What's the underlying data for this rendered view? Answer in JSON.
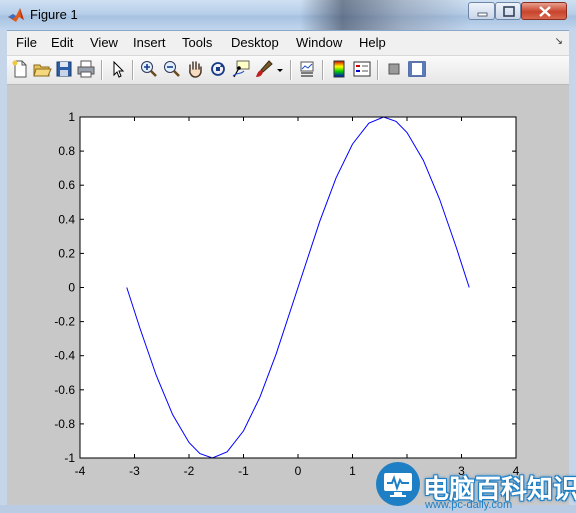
{
  "window": {
    "title": "Figure 1",
    "controls": [
      "minimize",
      "maximize",
      "close"
    ]
  },
  "menu": [
    {
      "label": "File"
    },
    {
      "label": "Edit"
    },
    {
      "label": "View"
    },
    {
      "label": "Insert"
    },
    {
      "label": "Tools"
    },
    {
      "label": "Desktop"
    },
    {
      "label": "Window"
    },
    {
      "label": "Help"
    }
  ],
  "toolbar": {
    "icons": [
      "new-figure-icon",
      "open-file-icon",
      "save-icon",
      "print-icon",
      "edit-plot-arrow-icon",
      "zoom-in-icon",
      "zoom-out-icon",
      "pan-hand-icon",
      "rotate-3d-icon",
      "data-cursor-icon",
      "brush-icon",
      "brush-dropdown-icon",
      "link-plot-icon",
      "colorbar-icon",
      "legend-icon",
      "hide-plot-tools-icon",
      "show-plot-tools-icon"
    ]
  },
  "chart_data": {
    "type": "line",
    "xlim": [
      -4,
      4
    ],
    "ylim": [
      -1,
      1
    ],
    "xticks": [
      "-4",
      "-3",
      "-2",
      "-1",
      "0",
      "1",
      "2",
      "3",
      "4"
    ],
    "yticks": [
      "1",
      "0.8",
      "0.6",
      "0.4",
      "0.2",
      "0",
      "-0.2",
      "-0.4",
      "-0.6",
      "-0.8",
      "-1"
    ],
    "series": [
      {
        "color": "#0000ff",
        "x": [
          -3.1416,
          -2.9,
          -2.6,
          -2.3,
          -2.0,
          -1.8,
          -1.5708,
          -1.3,
          -1.0,
          -0.7,
          -0.4,
          0.0,
          0.4,
          0.7,
          1.0,
          1.3,
          1.5708,
          1.8,
          2.0,
          2.3,
          2.6,
          2.9,
          3.1416
        ],
        "y": [
          0.0,
          -0.239,
          -0.516,
          -0.746,
          -0.909,
          -0.974,
          -1.0,
          -0.964,
          -0.841,
          -0.644,
          -0.389,
          0.0,
          0.389,
          0.644,
          0.841,
          0.964,
          1.0,
          0.974,
          0.909,
          0.746,
          0.516,
          0.239,
          0.0
        ]
      }
    ],
    "grid": false,
    "title": "",
    "xlabel": "",
    "ylabel": ""
  },
  "watermark": {
    "text": "电脑百科知识",
    "url": "www.pc-daily.com"
  },
  "colors": {
    "figure_bg": "#c8c8c8",
    "axes_bg": "#ffffff",
    "line": "#0000ff"
  }
}
